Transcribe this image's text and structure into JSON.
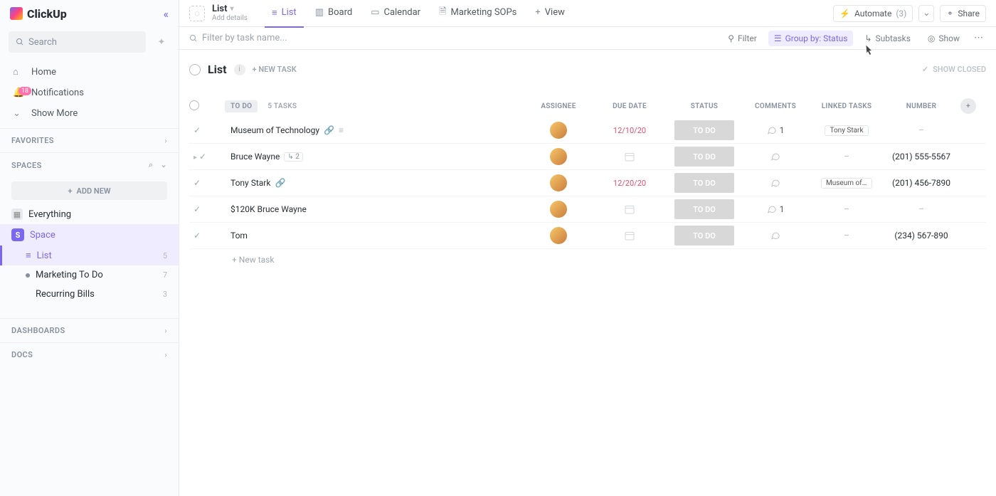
{
  "brand": "ClickUp",
  "sidebar": {
    "search_placeholder": "Search",
    "nav": [
      {
        "label": "Home"
      },
      {
        "label": "Notifications",
        "badge": "18"
      },
      {
        "label": "Show More"
      }
    ],
    "sections": {
      "favorites": "FAVORITES",
      "spaces": "SPACES",
      "dashboards": "DASHBOARDS",
      "docs": "DOCS"
    },
    "add_new": "ADD NEW",
    "everything": "Everything",
    "space_name": "Space",
    "lists": [
      {
        "label": "List",
        "count": "5",
        "active": true
      },
      {
        "label": "Marketing To Do",
        "count": "7"
      },
      {
        "label": "Recurring Bills",
        "count": "3"
      }
    ]
  },
  "topbar": {
    "title": "List",
    "subtitle": "Add details",
    "tabs": [
      {
        "label": "List",
        "active": true
      },
      {
        "label": "Board"
      },
      {
        "label": "Calendar"
      },
      {
        "label": "Marketing SOPs"
      },
      {
        "label": "View",
        "add": true
      }
    ],
    "automate_label": "Automate",
    "automate_count": "(3)",
    "share_label": "Share"
  },
  "toolbar": {
    "filter_placeholder": "Filter by task name...",
    "filter": "Filter",
    "groupby": "Group by: Status",
    "subtasks": "Subtasks",
    "show": "Show"
  },
  "group": {
    "title": "List",
    "new_task": "+ NEW TASK",
    "show_closed": "SHOW CLOSED",
    "status_label": "TO DO",
    "task_count": "5 TASKS"
  },
  "columns": [
    "ASSIGNEE",
    "DUE DATE",
    "STATUS",
    "COMMENTS",
    "LINKED TASKS",
    "NUMBER"
  ],
  "tasks": [
    {
      "name": "Museum of Technology",
      "link": true,
      "desc": true,
      "due": "12/10/20",
      "due_red": true,
      "status": "TO DO",
      "comments": "1",
      "linked": "Tony Stark",
      "number": "-"
    },
    {
      "name": "Bruce Wayne",
      "subtasks": "2",
      "caret": true,
      "due": "",
      "status": "TO DO",
      "comments": "",
      "linked": "-",
      "number": "(201) 555-5567"
    },
    {
      "name": "Tony Stark",
      "link": true,
      "due": "12/20/20",
      "due_red": true,
      "status": "TO DO",
      "comments": "",
      "linked": "Museum of ...",
      "number": "(201) 456-7890"
    },
    {
      "name": "$120K Bruce Wayne",
      "due": "",
      "status": "TO DO",
      "comments": "1",
      "linked": "-",
      "number": "-"
    },
    {
      "name": "Tom",
      "due": "",
      "status": "TO DO",
      "comments": "",
      "linked": "-",
      "number": "(234) 567-890"
    }
  ],
  "new_task_row": "+ New task"
}
